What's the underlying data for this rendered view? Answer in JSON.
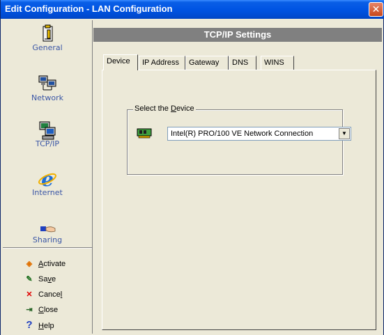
{
  "window": {
    "title": "Edit Configuration - LAN Configuration",
    "close_symbol": "✕"
  },
  "sidebar": {
    "items": [
      {
        "label": "General",
        "icon": "clipboard-icon"
      },
      {
        "label": "Network",
        "icon": "network-computers-icon"
      },
      {
        "label": "TCP/IP",
        "icon": "tcpip-computer-icon"
      },
      {
        "label": "Internet",
        "icon": "internet-explorer-icon"
      },
      {
        "label": "Sharing",
        "icon": "sharing-hand-icon"
      }
    ],
    "actions": [
      {
        "label": "Activate",
        "accel": "A",
        "rest": "ctivate",
        "icon": "activate-diamond-icon"
      },
      {
        "label": "Save",
        "accel": "v",
        "pre": "Sa",
        "rest": "e",
        "icon": "save-icon"
      },
      {
        "label": "Cancel",
        "accel": "l",
        "pre": "Cance",
        "rest": "",
        "icon": "cancel-x-icon"
      },
      {
        "label": "Close",
        "accel": "C",
        "rest": "lose",
        "icon": "close-door-icon"
      },
      {
        "label": "Help",
        "accel": "H",
        "rest": "elp",
        "icon": "help-question-icon"
      }
    ]
  },
  "header": {
    "title": "TCP/IP Settings"
  },
  "tabs": [
    {
      "label": "Device",
      "active": true
    },
    {
      "label": "IP Address",
      "active": false
    },
    {
      "label": "Gateway",
      "active": false
    },
    {
      "label": "DNS",
      "active": false
    },
    {
      "label": "WINS",
      "active": false
    }
  ],
  "device_group": {
    "label_pre": "Select the ",
    "label_accel": "D",
    "label_rest": "evice",
    "selected_device": "Intel(R) PRO/100 VE Network Connection",
    "dropdown_arrow": "▼"
  }
}
